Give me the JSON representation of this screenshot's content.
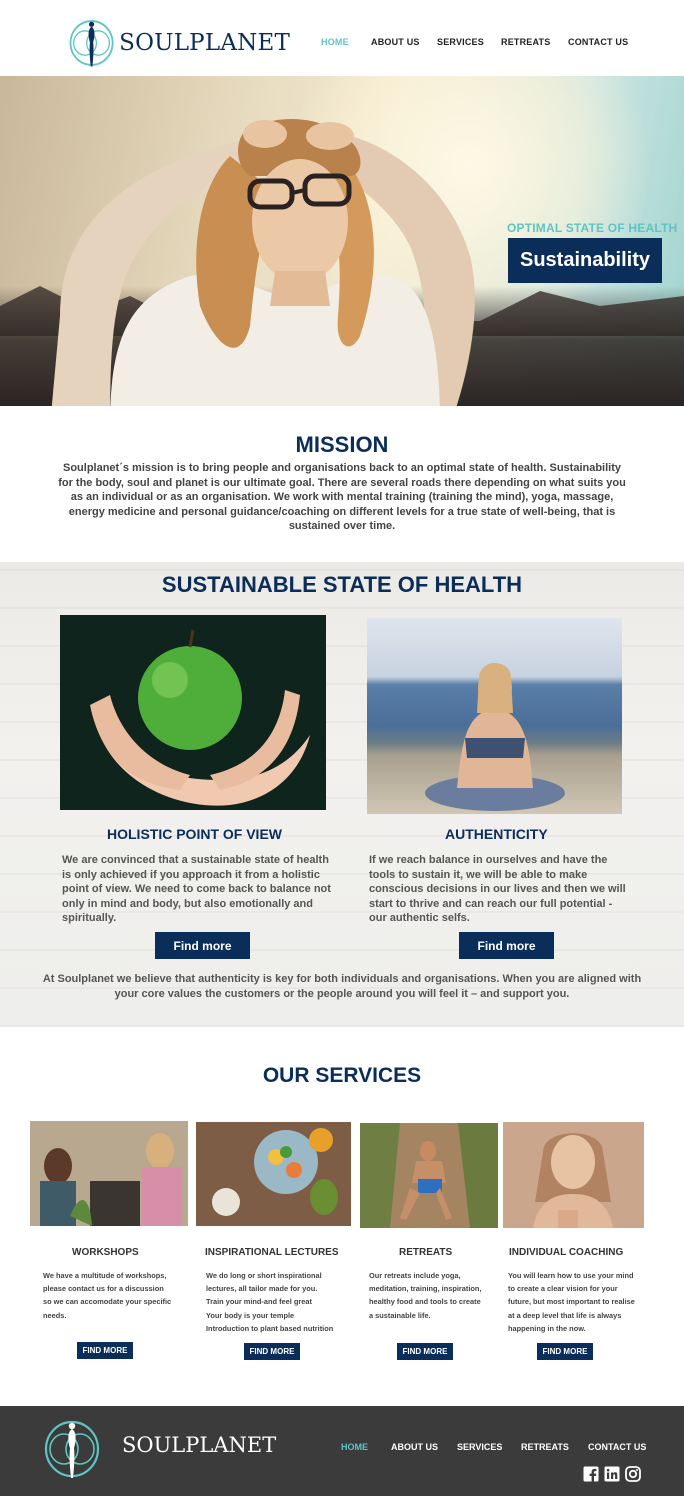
{
  "brand": {
    "name": "SOULPLANET"
  },
  "nav": {
    "items": [
      {
        "label": "HOME",
        "active": true
      },
      {
        "label": "ABOUT US",
        "active": false
      },
      {
        "label": "SERVICES",
        "active": false
      },
      {
        "label": "RETREATS",
        "active": false
      },
      {
        "label": "CONTACT US",
        "active": false
      }
    ]
  },
  "hero": {
    "subtitle": "OPTIMAL STATE OF HEALTH",
    "button_label": "Sustainability"
  },
  "mission": {
    "title": "MISSION",
    "text": "Soulplanet´s mission is to bring people and organisations back to an optimal state of health. Sustainability for the body, soul and planet is our ultimate goal. There are several roads there depending on what suits you as an individual or as an organisation. We work with mental training (training the mind), yoga, massage, energy medicine and personal guidance/coaching on different levels for a true state of well-being, that is sustained over time."
  },
  "sustainable": {
    "title": "SUSTAINABLE STATE OF HEALTH",
    "columns": [
      {
        "title": "HOLISTIC POINT OF VIEW",
        "text": "We are convinced that a sustainable state of health is only achieved if you approach it from a holistic point of view. We need to come back to balance not only in mind and body, but also emotionally and spiritually.",
        "button_label": "Find more"
      },
      {
        "title": "AUTHENTICITY",
        "text": "If we reach balance in ourselves and have the tools to sustain it, we will be able to make conscious decisions in our lives and then we will start to thrive and can reach our full potential - our authentic selfs.",
        "button_label": "Find more"
      }
    ],
    "bottom_text": "At Soulplanet we believe that authenticity is key for both individuals and organisations. When you are aligned with your core values the customers or the people around you will feel it – and support you."
  },
  "services": {
    "title": "OUR SERVICES",
    "items": [
      {
        "title": "WORKSHOPS",
        "lines": [
          "We have a multitude of workshops,",
          "please contact us for a discussion",
          "so we can accomodate your specific",
          "needs."
        ],
        "button_label": "FIND MORE"
      },
      {
        "title": "INSPIRATIONAL LECTURES",
        "lines": [
          "We do long or short inspirational",
          "lectures, all tailor made for you.",
          "Train your mind-and feel great",
          "Your body is your temple",
          "Introduction to plant based nutrition"
        ],
        "button_label": "FIND MORE"
      },
      {
        "title": "RETREATS",
        "lines": [
          "Our retreats include yoga,",
          "meditation, training, inspiration,",
          "healthy food and tools to create",
          "a sustainable life."
        ],
        "button_label": "FIND MORE"
      },
      {
        "title": "INDIVIDUAL COACHING",
        "lines": [
          "You will learn how to use your mind",
          "to create a clear vision for your",
          "future, but most important to realise",
          "at a deep level that life is always",
          "happening in the now."
        ],
        "button_label": "FIND MORE"
      }
    ]
  },
  "footer": {
    "brand": "SOULPLANET",
    "nav": [
      "HOME",
      "ABOUT US",
      "SERVICES",
      "RETREATS",
      "CONTACT US"
    ],
    "social_icons": [
      "facebook-icon",
      "linkedin-icon",
      "instagram-icon"
    ]
  },
  "colors": {
    "navy": "#0b2d5a",
    "teal": "#5ec4c4",
    "footer_bg": "#3b3b3b"
  }
}
